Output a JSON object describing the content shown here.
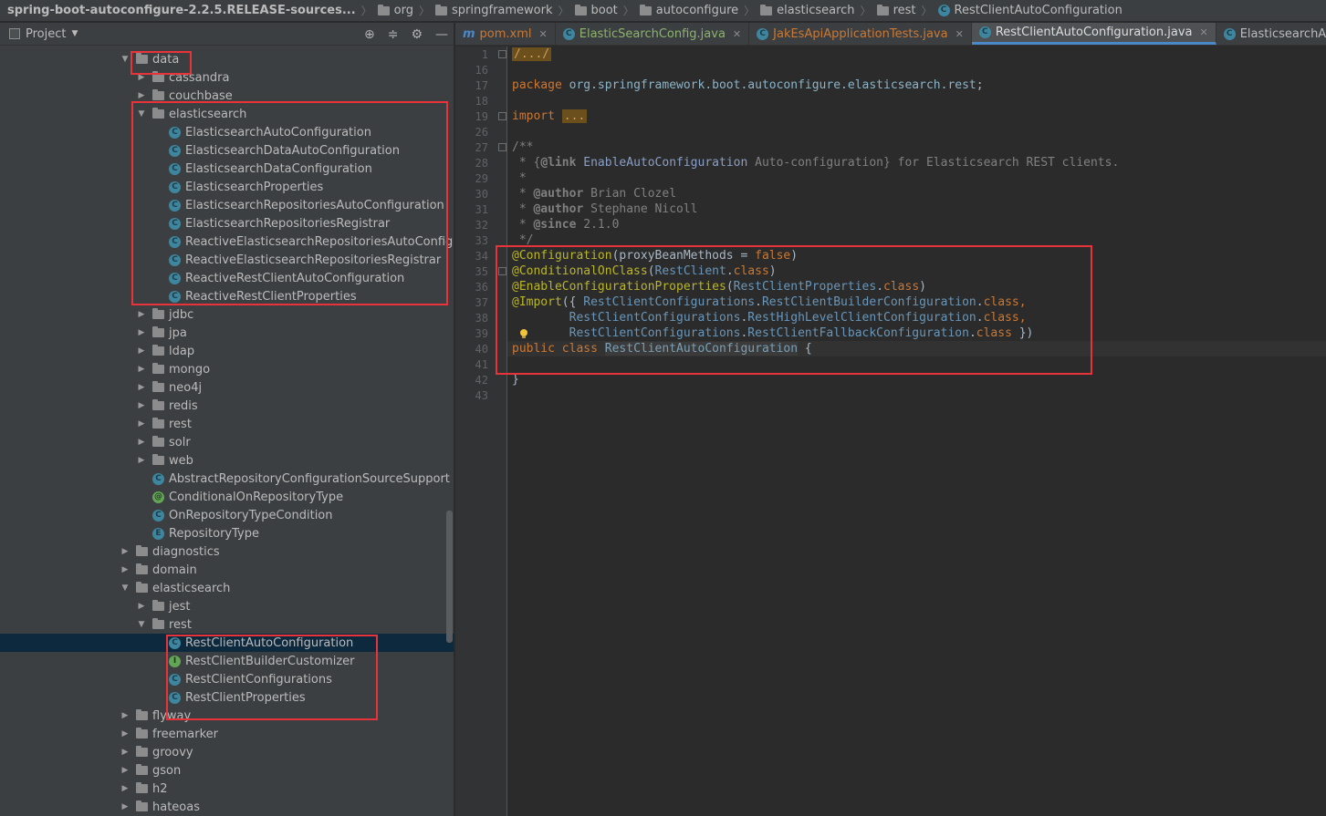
{
  "breadcrumb": {
    "root": "spring-boot-autoconfigure-2.2.5.RELEASE-sources...",
    "parts": [
      "org",
      "springframework",
      "boot",
      "autoconfigure",
      "elasticsearch",
      "rest"
    ],
    "current": "RestClientAutoConfiguration"
  },
  "project_panel": {
    "title": "Project"
  },
  "tree": [
    {
      "label": "data",
      "depth": 1,
      "arrow": "down",
      "icon": "folder"
    },
    {
      "label": "cassandra",
      "depth": 2,
      "arrow": "right",
      "icon": "folder"
    },
    {
      "label": "couchbase",
      "depth": 2,
      "arrow": "right",
      "icon": "folder"
    },
    {
      "label": "elasticsearch",
      "depth": 2,
      "arrow": "down",
      "icon": "folder"
    },
    {
      "label": "ElasticsearchAutoConfiguration",
      "depth": 3,
      "arrow": "none",
      "icon": "class"
    },
    {
      "label": "ElasticsearchDataAutoConfiguration",
      "depth": 3,
      "arrow": "none",
      "icon": "class"
    },
    {
      "label": "ElasticsearchDataConfiguration",
      "depth": 3,
      "arrow": "none",
      "icon": "class"
    },
    {
      "label": "ElasticsearchProperties",
      "depth": 3,
      "arrow": "none",
      "icon": "class"
    },
    {
      "label": "ElasticsearchRepositoriesAutoConfiguration",
      "depth": 3,
      "arrow": "none",
      "icon": "class"
    },
    {
      "label": "ElasticsearchRepositoriesRegistrar",
      "depth": 3,
      "arrow": "none",
      "icon": "class"
    },
    {
      "label": "ReactiveElasticsearchRepositoriesAutoConfiguratio",
      "depth": 3,
      "arrow": "none",
      "icon": "class"
    },
    {
      "label": "ReactiveElasticsearchRepositoriesRegistrar",
      "depth": 3,
      "arrow": "none",
      "icon": "class"
    },
    {
      "label": "ReactiveRestClientAutoConfiguration",
      "depth": 3,
      "arrow": "none",
      "icon": "class"
    },
    {
      "label": "ReactiveRestClientProperties",
      "depth": 3,
      "arrow": "none",
      "icon": "class"
    },
    {
      "label": "jdbc",
      "depth": 2,
      "arrow": "right",
      "icon": "folder"
    },
    {
      "label": "jpa",
      "depth": 2,
      "arrow": "right",
      "icon": "folder"
    },
    {
      "label": "ldap",
      "depth": 2,
      "arrow": "right",
      "icon": "folder"
    },
    {
      "label": "mongo",
      "depth": 2,
      "arrow": "right",
      "icon": "folder"
    },
    {
      "label": "neo4j",
      "depth": 2,
      "arrow": "right",
      "icon": "folder"
    },
    {
      "label": "redis",
      "depth": 2,
      "arrow": "right",
      "icon": "folder"
    },
    {
      "label": "rest",
      "depth": 2,
      "arrow": "right",
      "icon": "folder"
    },
    {
      "label": "solr",
      "depth": 2,
      "arrow": "right",
      "icon": "folder"
    },
    {
      "label": "web",
      "depth": 2,
      "arrow": "right",
      "icon": "folder"
    },
    {
      "label": "AbstractRepositoryConfigurationSourceSupport",
      "depth": 2,
      "arrow": "none",
      "icon": "class"
    },
    {
      "label": "ConditionalOnRepositoryType",
      "depth": 2,
      "arrow": "none",
      "icon": "annotation"
    },
    {
      "label": "OnRepositoryTypeCondition",
      "depth": 2,
      "arrow": "none",
      "icon": "class"
    },
    {
      "label": "RepositoryType",
      "depth": 2,
      "arrow": "none",
      "icon": "enum"
    },
    {
      "label": "diagnostics",
      "depth": 1,
      "arrow": "right",
      "icon": "folder"
    },
    {
      "label": "domain",
      "depth": 1,
      "arrow": "right",
      "icon": "folder"
    },
    {
      "label": "elasticsearch",
      "depth": 1,
      "arrow": "down",
      "icon": "folder"
    },
    {
      "label": "jest",
      "depth": 2,
      "arrow": "right",
      "icon": "folder"
    },
    {
      "label": "rest",
      "depth": 2,
      "arrow": "down",
      "icon": "folder"
    },
    {
      "label": "RestClientAutoConfiguration",
      "depth": 3,
      "arrow": "none",
      "icon": "class",
      "selected": true
    },
    {
      "label": "RestClientBuilderCustomizer",
      "depth": 3,
      "arrow": "none",
      "icon": "interface"
    },
    {
      "label": "RestClientConfigurations",
      "depth": 3,
      "arrow": "none",
      "icon": "class"
    },
    {
      "label": "RestClientProperties",
      "depth": 3,
      "arrow": "none",
      "icon": "class"
    },
    {
      "label": "flyway",
      "depth": 1,
      "arrow": "right",
      "icon": "folder"
    },
    {
      "label": "freemarker",
      "depth": 1,
      "arrow": "right",
      "icon": "folder"
    },
    {
      "label": "groovy",
      "depth": 1,
      "arrow": "right",
      "icon": "folder"
    },
    {
      "label": "gson",
      "depth": 1,
      "arrow": "right",
      "icon": "folder"
    },
    {
      "label": "h2",
      "depth": 1,
      "arrow": "right",
      "icon": "folder"
    },
    {
      "label": "hateoas",
      "depth": 1,
      "arrow": "right",
      "icon": "folder"
    }
  ],
  "tabs": [
    {
      "label": "pom.xml",
      "icon": "m",
      "style": "orange",
      "active": false
    },
    {
      "label": "ElasticSearchConfig.java",
      "icon": "class",
      "style": "green",
      "active": false
    },
    {
      "label": "JakEsApiApplicationTests.java",
      "icon": "class-test",
      "style": "orange",
      "active": false
    },
    {
      "label": "RestClientAutoConfiguration.java",
      "icon": "class",
      "style": "normal",
      "active": true
    },
    {
      "label": "ElasticsearchAutoConfiguration",
      "icon": "class",
      "style": "normal",
      "active": false
    }
  ],
  "editor": {
    "line_numbers": [
      "1",
      "16",
      "17",
      "18",
      "19",
      "26",
      "27",
      "28",
      "29",
      "30",
      "31",
      "32",
      "33",
      "34",
      "35",
      "36",
      "37",
      "38",
      "39",
      "40",
      "41",
      "42",
      "43"
    ],
    "folded_header": "/.../",
    "package_kw": "package",
    "package_name": "org.springframework.boot.autoconfigure.elasticsearch.rest",
    "import_kw": "import",
    "import_fold": "...",
    "doc_open": "/**",
    "doc_line1_pre": " * {",
    "doc_link_tag": "@link",
    "doc_link_target": "EnableAutoConfiguration",
    "doc_line1_post": " Auto-configuration} for Elasticsearch REST clients.",
    "doc_blank": " *",
    "doc_author1_tag": "@author",
    "doc_author1": " Brian Clozel",
    "doc_author2_tag": "@author",
    "doc_author2": " Stephane Nicoll",
    "doc_since_tag": "@since",
    "doc_since": " 2.1.0",
    "doc_close": " */",
    "ann_configuration": "@Configuration",
    "ann_configuration_args_pre": "(proxyBeanMethods = ",
    "ann_configuration_false": "false",
    "ann_configuration_args_post": ")",
    "ann_conditional": "@ConditionalOnClass",
    "ann_conditional_class": "RestClient",
    "ann_enable_props": "@EnableConfigurationProperties",
    "ann_enable_props_class": "RestClientProperties",
    "ann_import": "@Import",
    "import_cfg1_owner": "RestClientConfigurations",
    "import_cfg1": "RestClientBuilderConfiguration",
    "import_cfg2_owner": "RestClientConfigurations",
    "import_cfg2": "RestHighLevelClientConfiguration",
    "import_cfg3_owner": "RestClientConfigurations",
    "import_cfg3": "RestClientFallbackConfiguration",
    "class_kw": "class",
    "public_kw": "public",
    "class_name": "RestClientAutoConfiguration",
    "closing_brace": "}"
  },
  "colors": {
    "highlight_box": "#e8333a",
    "keyword": "#cc7832",
    "annotation": "#bbb529",
    "class_ref": "#6897bb",
    "doc_comment": "#629755"
  }
}
